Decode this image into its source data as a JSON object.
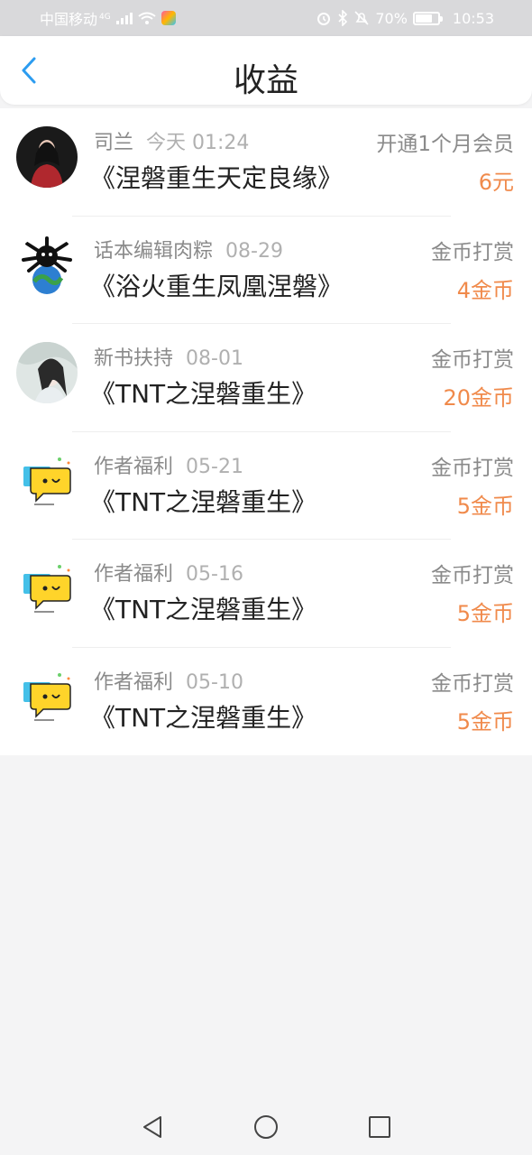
{
  "status_bar": {
    "carrier": "中国移动",
    "network": "4G",
    "battery": "70%",
    "time": "10:53"
  },
  "header": {
    "title": "收益",
    "back_icon": "chevron-left-icon"
  },
  "colors": {
    "accent": "#2c9cf0",
    "amount": "#f08a4b"
  },
  "items": [
    {
      "user": "司兰",
      "date": "今天 01:24",
      "book": "《涅磐重生天定良缘》",
      "type": "开通1个月会员",
      "amount": "6元",
      "avatar": "photo-avatar"
    },
    {
      "user": "话本编辑肉粽",
      "date": "08-29",
      "book": "《浴火重生凤凰涅磐》",
      "type": "金币打赏",
      "amount": "4金币",
      "avatar": "cartoon-avatar"
    },
    {
      "user": "新书扶持",
      "date": "08-01",
      "book": "《TNT之涅磐重生》",
      "type": "金币打赏",
      "amount": "20金币",
      "avatar": "illustration-avatar"
    },
    {
      "user": "作者福利",
      "date": "05-21",
      "book": "《TNT之涅磐重生》",
      "type": "金币打赏",
      "amount": "5金币",
      "avatar": "chat-bubble-avatar"
    },
    {
      "user": "作者福利",
      "date": "05-16",
      "book": "《TNT之涅磐重生》",
      "type": "金币打赏",
      "amount": "5金币",
      "avatar": "chat-bubble-avatar"
    },
    {
      "user": "作者福利",
      "date": "05-10",
      "book": "《TNT之涅磐重生》",
      "type": "金币打赏",
      "amount": "5金币",
      "avatar": "chat-bubble-avatar"
    }
  ]
}
